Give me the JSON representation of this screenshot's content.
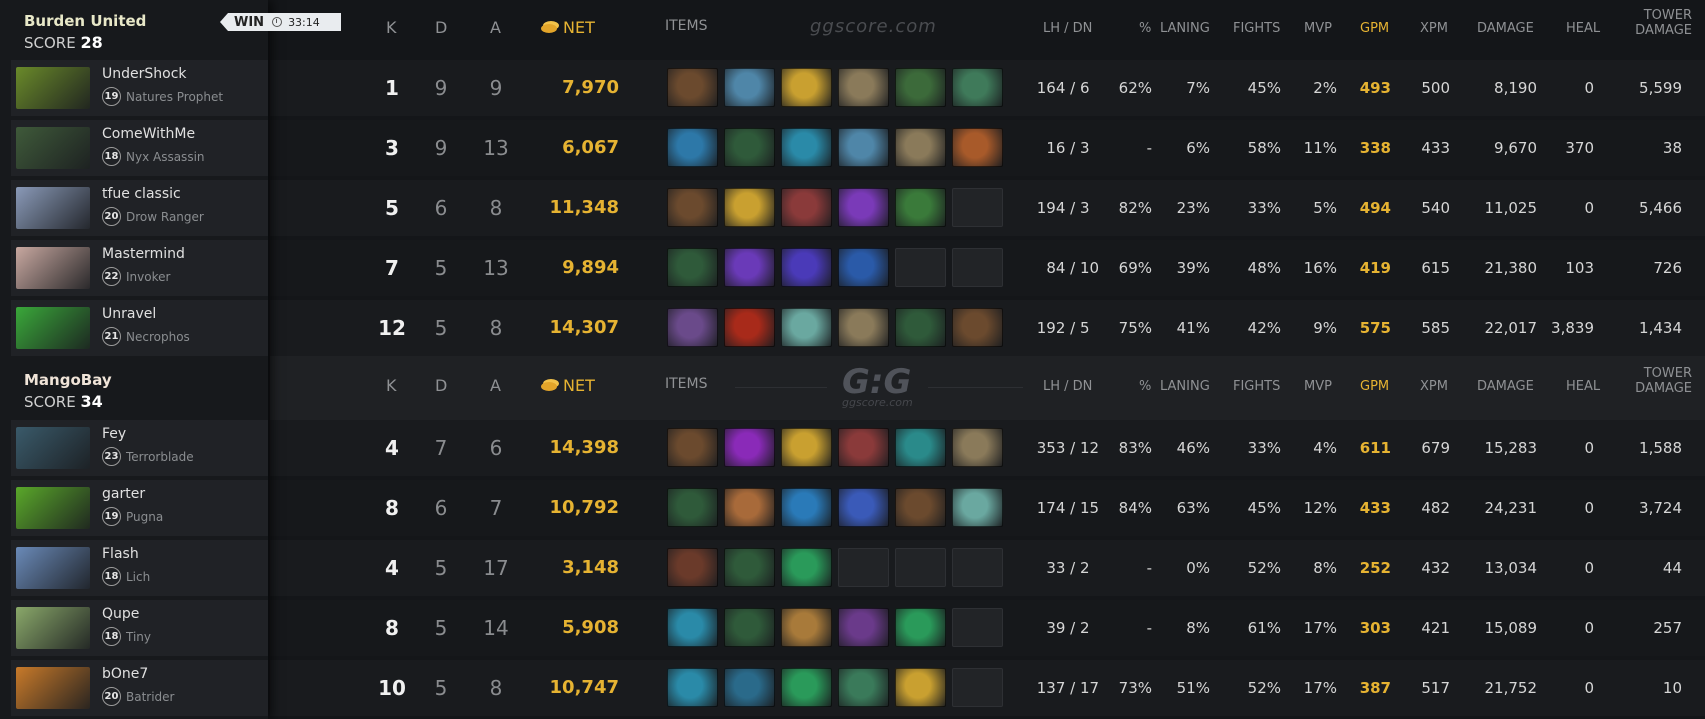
{
  "match": {
    "result": "WIN",
    "duration": "33:14",
    "watermark": "ggscore.com",
    "logo": "G:G",
    "logo_sub": "ggscore.com"
  },
  "headers": {
    "k": "K",
    "d": "D",
    "a": "A",
    "net": "NET",
    "items": "ITEMS",
    "lhdn": "LH / DN",
    "pct": "%",
    "laning": "LANING",
    "fights": "FIGHTS",
    "mvp": "MVP",
    "gpm": "GPM",
    "xpm": "XPM",
    "damage": "DAMAGE",
    "heal": "HEAL",
    "tower1": "TOWER",
    "tower2": "DAMAGE"
  },
  "teams": [
    {
      "name": "Burden United",
      "score_label": "SCORE",
      "score": "28",
      "players": [
        {
          "name": "UnderShock",
          "level": "19",
          "hero": "Natures Prophet",
          "avatar": "#6a8a2a",
          "k": "1",
          "d": "9",
          "a": "9",
          "net": "7,970",
          "lh": "164",
          "dn": "6",
          "pct": "62%",
          "laning": "7%",
          "fights": "45%",
          "mvp": "2%",
          "gpm": "493",
          "xpm": "500",
          "damage": "8,190",
          "heal": "0",
          "tower": "5,599",
          "items": [
            "#6b4a2e",
            "#4f86a8",
            "#c9a030",
            "#8a7a5a",
            "#3c6a3a",
            "#3f7a5a"
          ]
        },
        {
          "name": "ComeWithMe",
          "level": "18",
          "hero": "Nyx Assassin",
          "avatar": "#3f5a3a",
          "k": "3",
          "d": "9",
          "a": "13",
          "net": "6,067",
          "lh": "16",
          "dn": "3",
          "pct": "-",
          "laning": "6%",
          "fights": "58%",
          "mvp": "11%",
          "gpm": "338",
          "xpm": "433",
          "damage": "9,670",
          "heal": "370",
          "tower": "38",
          "items": [
            "#2d78a8",
            "#2f5a3a",
            "#2a8aa8",
            "#4f86a8",
            "#8a7a5a",
            "#a85a2a"
          ]
        },
        {
          "name": "tfue classic",
          "level": "20",
          "hero": "Drow Ranger",
          "avatar": "#8a9ab8",
          "k": "5",
          "d": "6",
          "a": "8",
          "net": "11,348",
          "lh": "194",
          "dn": "3",
          "pct": "82%",
          "laning": "23%",
          "fights": "33%",
          "mvp": "5%",
          "gpm": "494",
          "xpm": "540",
          "damage": "11,025",
          "heal": "0",
          "tower": "5,466",
          "items": [
            "#6b4a2e",
            "#c9a030",
            "#8a3a3a",
            "#7a3ab8",
            "#3a7a3a",
            ""
          ]
        },
        {
          "name": "Mastermind",
          "level": "22",
          "hero": "Invoker",
          "avatar": "#c8a8a0",
          "k": "7",
          "d": "5",
          "a": "13",
          "net": "9,894",
          "lh": "84",
          "dn": "10",
          "pct": "69%",
          "laning": "39%",
          "fights": "48%",
          "mvp": "16%",
          "gpm": "419",
          "xpm": "615",
          "damage": "21,380",
          "heal": "103",
          "tower": "726",
          "items": [
            "#2f5a3a",
            "#6a3ab8",
            "#4a3ab8",
            "#2a5aa8",
            "",
            ""
          ]
        },
        {
          "name": "Unravel",
          "level": "21",
          "hero": "Necrophos",
          "avatar": "#3aa83a",
          "k": "12",
          "d": "5",
          "a": "8",
          "net": "14,307",
          "lh": "192",
          "dn": "5",
          "pct": "75%",
          "laning": "41%",
          "fights": "42%",
          "mvp": "9%",
          "gpm": "575",
          "xpm": "585",
          "damage": "22,017",
          "heal": "3,839",
          "tower": "1,434",
          "items": [
            "#6a4a8a",
            "#a82a1a",
            "#6aa8a0",
            "#8a7a5a",
            "#2f5a3a",
            "#6b4a2e"
          ]
        }
      ]
    },
    {
      "name": "MangoBay",
      "score_label": "SCORE",
      "score": "34",
      "players": [
        {
          "name": "Fey",
          "level": "23",
          "hero": "Terrorblade",
          "avatar": "#3a5a6a",
          "k": "4",
          "d": "7",
          "a": "6",
          "net": "14,398",
          "lh": "353",
          "dn": "12",
          "pct": "83%",
          "laning": "46%",
          "fights": "33%",
          "mvp": "4%",
          "gpm": "611",
          "xpm": "679",
          "damage": "15,283",
          "heal": "0",
          "tower": "1,588",
          "items": [
            "#6b4a2e",
            "#8a2ab8",
            "#c9a030",
            "#8a3a3a",
            "#2a8a8a",
            "#8a7a5a"
          ]
        },
        {
          "name": "garter",
          "level": "19",
          "hero": "Pugna",
          "avatar": "#5aa82a",
          "k": "8",
          "d": "6",
          "a": "7",
          "net": "10,792",
          "lh": "174",
          "dn": "15",
          "pct": "84%",
          "laning": "63%",
          "fights": "45%",
          "mvp": "12%",
          "gpm": "433",
          "xpm": "482",
          "damage": "24,231",
          "heal": "0",
          "tower": "3,724",
          "items": [
            "#2f5a3a",
            "#a86a3a",
            "#2a7ab8",
            "#3a5ab8",
            "#6b4a2e",
            "#6aa8a0"
          ]
        },
        {
          "name": "Flash",
          "level": "18",
          "hero": "Lich",
          "avatar": "#6a8ab8",
          "k": "4",
          "d": "5",
          "a": "17",
          "net": "3,148",
          "lh": "33",
          "dn": "2",
          "pct": "-",
          "laning": "0%",
          "fights": "52%",
          "mvp": "8%",
          "gpm": "252",
          "xpm": "432",
          "damage": "13,034",
          "heal": "0",
          "tower": "44",
          "items": [
            "#6a3a2a",
            "#2f5a3a",
            "#2a9a5a",
            "",
            "",
            ""
          ]
        },
        {
          "name": "Qupe",
          "level": "18",
          "hero": "Tiny",
          "avatar": "#8aa86a",
          "k": "8",
          "d": "5",
          "a": "14",
          "net": "5,908",
          "lh": "39",
          "dn": "2",
          "pct": "-",
          "laning": "8%",
          "fights": "61%",
          "mvp": "17%",
          "gpm": "303",
          "xpm": "421",
          "damage": "15,089",
          "heal": "0",
          "tower": "257",
          "items": [
            "#2a8aa8",
            "#2f5a3a",
            "#a87a3a",
            "#6a3a8a",
            "#2a9a5a",
            ""
          ]
        },
        {
          "name": "bOne7",
          "level": "20",
          "hero": "Batrider",
          "avatar": "#c87a2a",
          "k": "10",
          "d": "5",
          "a": "8",
          "net": "10,747",
          "lh": "137",
          "dn": "17",
          "pct": "73%",
          "laning": "51%",
          "fights": "52%",
          "mvp": "17%",
          "gpm": "387",
          "xpm": "517",
          "damage": "21,752",
          "heal": "0",
          "tower": "10",
          "items": [
            "#2a8aa8",
            "#2a6a8a",
            "#2a9a5a",
            "#3a7a5a",
            "#c9a030",
            ""
          ]
        }
      ]
    }
  ]
}
